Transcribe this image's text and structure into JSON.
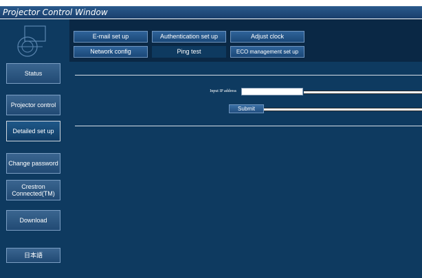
{
  "window": {
    "title": "Projector Control Window"
  },
  "sidebar": {
    "items": [
      {
        "label": "Status"
      },
      {
        "label": "Projector control"
      },
      {
        "label": "Detailed set up"
      },
      {
        "label": "Change password"
      },
      {
        "label": "Crestron Connected(TM)"
      },
      {
        "label": "Download"
      },
      {
        "label": "日本語"
      }
    ],
    "active": "Detailed set up"
  },
  "tabs": {
    "row1": [
      "E-mail set up",
      "Authentication set up",
      "Adjust clock"
    ],
    "row2": [
      "Network config",
      "Ping test",
      "ECO management set up"
    ],
    "active": "Ping test"
  },
  "ping": {
    "ip_label": "Input IP address",
    "ip_value": "",
    "submit_label": "Submit"
  },
  "colors": {
    "background": "#0e3a60",
    "tab_band": "#0a2845",
    "button": "#2a5a8c",
    "text": "#ffffff"
  },
  "icons": [
    "logo-icon"
  ]
}
